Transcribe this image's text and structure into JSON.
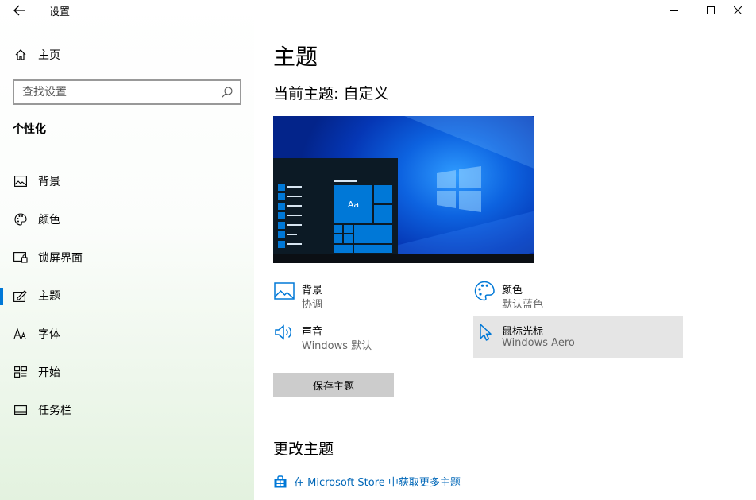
{
  "window": {
    "title": "设置"
  },
  "sidebar": {
    "home_label": "主页",
    "search_placeholder": "查找设置",
    "section_title": "个性化",
    "items": [
      {
        "label": "背景",
        "icon": "picture-icon"
      },
      {
        "label": "颜色",
        "icon": "palette-icon"
      },
      {
        "label": "锁屏界面",
        "icon": "lock-screen-icon"
      },
      {
        "label": "主题",
        "icon": "theme-icon",
        "active": true
      },
      {
        "label": "字体",
        "icon": "font-icon"
      },
      {
        "label": "开始",
        "icon": "start-icon"
      },
      {
        "label": "任务栏",
        "icon": "taskbar-icon"
      }
    ]
  },
  "main": {
    "title": "主题",
    "current_theme": "当前主题: 自定义",
    "preview_tile_text": "Aa",
    "settings": [
      {
        "title": "背景",
        "value": "协调",
        "icon": "picture-icon"
      },
      {
        "title": "颜色",
        "value": "默认蓝色",
        "icon": "palette-icon"
      },
      {
        "title": "声音",
        "value": "Windows 默认",
        "icon": "speaker-icon"
      },
      {
        "title": "鼠标光标",
        "value": "Windows Aero",
        "icon": "cursor-icon"
      }
    ],
    "save_button": "保存主题",
    "change_title": "更改主题",
    "store_link": "在 Microsoft Store 中获取更多主题"
  },
  "colors": {
    "accent": "#0078d7",
    "link": "#0067b8",
    "button_bg": "#cccccc"
  }
}
